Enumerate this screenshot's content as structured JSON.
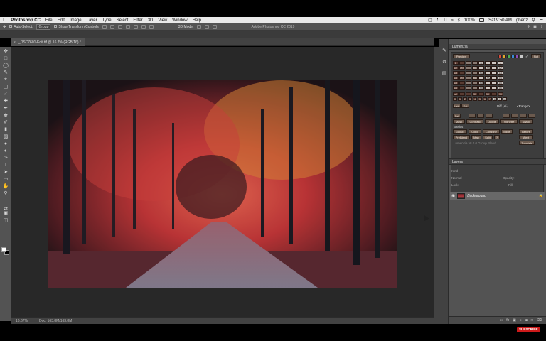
{
  "menubar": {
    "apple_icon": "apple-logo-icon",
    "app_name": "Photoshop CC",
    "items": [
      "File",
      "Edit",
      "Image",
      "Layer",
      "Type",
      "Select",
      "Filter",
      "3D",
      "View",
      "Window",
      "Help"
    ],
    "battery": "100%",
    "clock": "Sat 9:50 AM",
    "user": "gbenz"
  },
  "optionsbar": {
    "auto_select_label": "Auto-Select:",
    "auto_select_value": "Group",
    "transform_label": "Show Transform Controls",
    "mode_label": "3D Mode:",
    "app_title": "Adobe Photoshop CC 2019"
  },
  "document": {
    "tab_title": "_DSC7601-Edit.tif @ 16.7% (RGB/16) *",
    "zoom": "16.67%",
    "doc_size": "Doc: 163.8M/163.8M"
  },
  "lumenzia": {
    "title": "Lumenzia",
    "preview_label": "Preview",
    "not_label": "Not",
    "rows": [
      [
        "D",
        "",
        "",
        "",
        "M",
        "",
        "",
        "L"
      ],
      [
        "D2",
        "DM1",
        "",
        "M1",
        "",
        "LM1",
        "",
        "L2"
      ],
      [
        "D3",
        "",
        "",
        "",
        "M2",
        "",
        "",
        "L3"
      ],
      [
        "D4",
        "DM2",
        "",
        "M3",
        "",
        "LM2",
        "",
        "L4"
      ],
      [
        "D5",
        "",
        "",
        "",
        "M4",
        "",
        "",
        "L5"
      ],
      [
        "D6",
        "",
        "",
        "",
        "M5",
        "",
        "",
        "L6"
      ]
    ],
    "zone_row": [
      "all",
      "",
      "",
      "30",
      "",
      "50",
      "",
      "70"
    ],
    "num_row": [
      "0",
      "1",
      "2",
      "3",
      "4",
      "5",
      "6",
      "7",
      "8",
      "9",
      "10"
    ],
    "vals_label": "Vals",
    "sat_label": "Sat",
    "diff_label": "Diff (+/-)",
    "range_label": "<Range>",
    "buttons_row1": [
      "Sel",
      "",
      "",
      "",
      "",
      "",
      "",
      ""
    ],
    "buttons_row2": [
      "Mask",
      "Contrast",
      "Dodge",
      "Vignette",
      "Sharp"
    ],
    "basics_label": "Basics",
    "buttons_row3": [
      "Group",
      "Color",
      "Combine",
      "Edge",
      "Before"
    ],
    "buttons_row4": [
      "PreBlend",
      "Map",
      "Split",
      "?",
      "Alert"
    ],
    "version_label": "Lumenzia v8.0.0  Group Blend",
    "tutorials_label": "Tutorials",
    "colors": [
      "#d94a3a",
      "#e0a62d",
      "#4caf50",
      "#3b8ad6",
      "#8e4bb8",
      "#c9c9c9"
    ]
  },
  "layers": {
    "title": "Layers",
    "kind_label": "Kind",
    "mode_label": "Normal",
    "opacity_label": "Opacity:",
    "lock_label": "Lock:",
    "fill_label": "Fill:",
    "layer_name": "Background",
    "footer_icons": [
      "link-icon",
      "fx-icon",
      "mask-icon",
      "adjustment-icon",
      "folder-icon",
      "new-layer-icon",
      "trash-icon"
    ]
  },
  "overlay": {
    "subscribe_label": "SUBSCRIBE"
  }
}
